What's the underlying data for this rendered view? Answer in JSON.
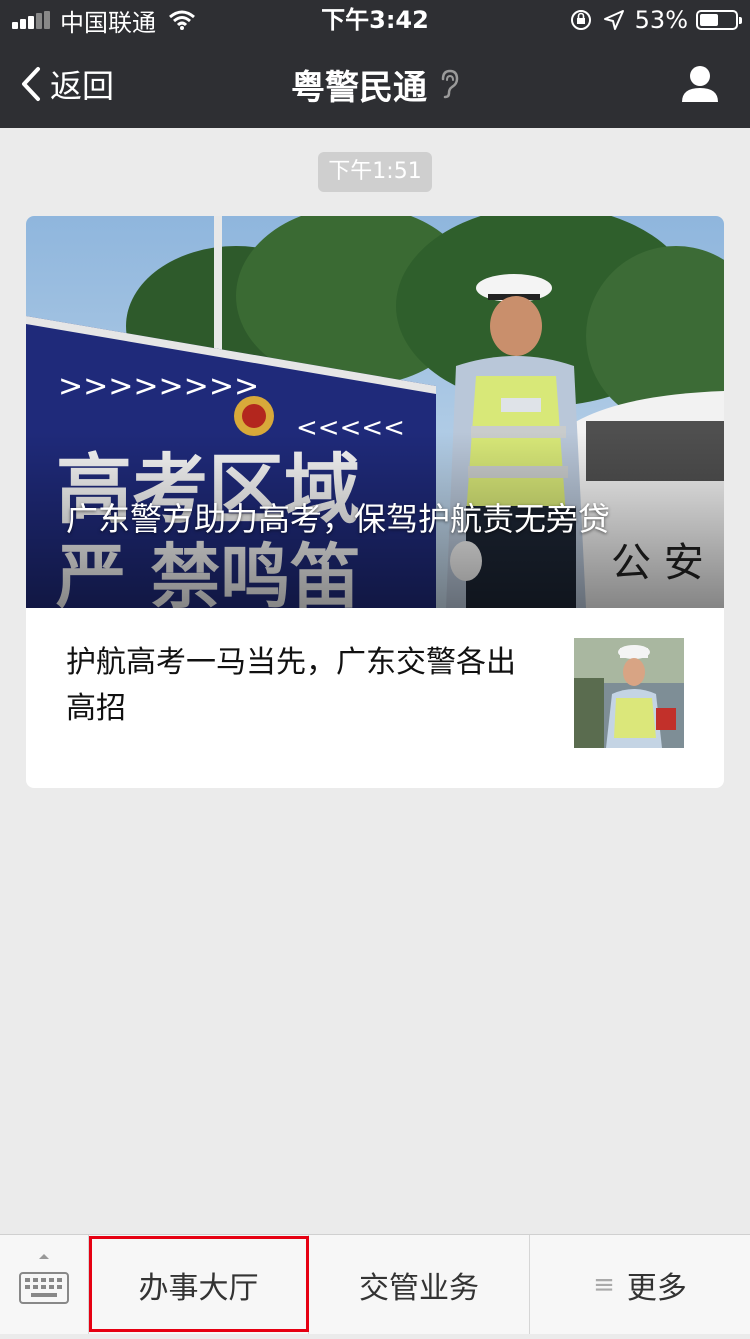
{
  "status_bar": {
    "carrier": "中国联通",
    "time": "下午3:42",
    "battery": "53%",
    "battery_level": 0.53
  },
  "nav": {
    "back_label": "返回",
    "title": "粤警民通",
    "icons": [
      "chevron-left-icon",
      "ear-icon",
      "user-icon"
    ]
  },
  "chat": {
    "timestamp": "下午1:51",
    "article": {
      "hero_title": "广东警方助力高考，保驾护航责无旁贷",
      "item_title": "护航高考一马当先，广东交警各出高招"
    }
  },
  "bottom_menu": {
    "items": [
      {
        "label": "办事大厅"
      },
      {
        "label": "交管业务"
      },
      {
        "label": "更多"
      }
    ],
    "highlight_color": "#e60012"
  },
  "colors": {
    "nav_bg": "#2e2f33",
    "page_bg": "#ebebeb"
  }
}
